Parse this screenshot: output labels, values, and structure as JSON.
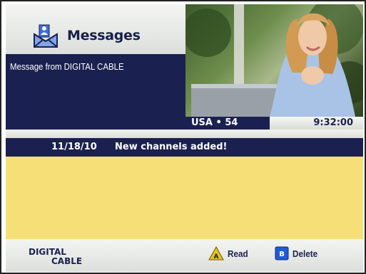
{
  "header": {
    "title": "Messages",
    "icon": "envelope-person-icon"
  },
  "message_panel": {
    "text": "Message from DIGITAL CABLE"
  },
  "tv": {
    "channel": "USA • 54",
    "time": "9:32:00"
  },
  "messages": [
    {
      "date": "11/18/10",
      "subject": "New channels added!"
    }
  ],
  "footer": {
    "logo_line1": "DIGITAL",
    "logo_line2": "CABLE",
    "buttons": [
      {
        "key": "A",
        "label": "Read",
        "color": "#e8c21c"
      },
      {
        "key": "B",
        "label": "Delete",
        "color": "#1f5bd6"
      }
    ]
  },
  "colors": {
    "navy": "#1a2150",
    "body_yellow": "#f7df78"
  }
}
